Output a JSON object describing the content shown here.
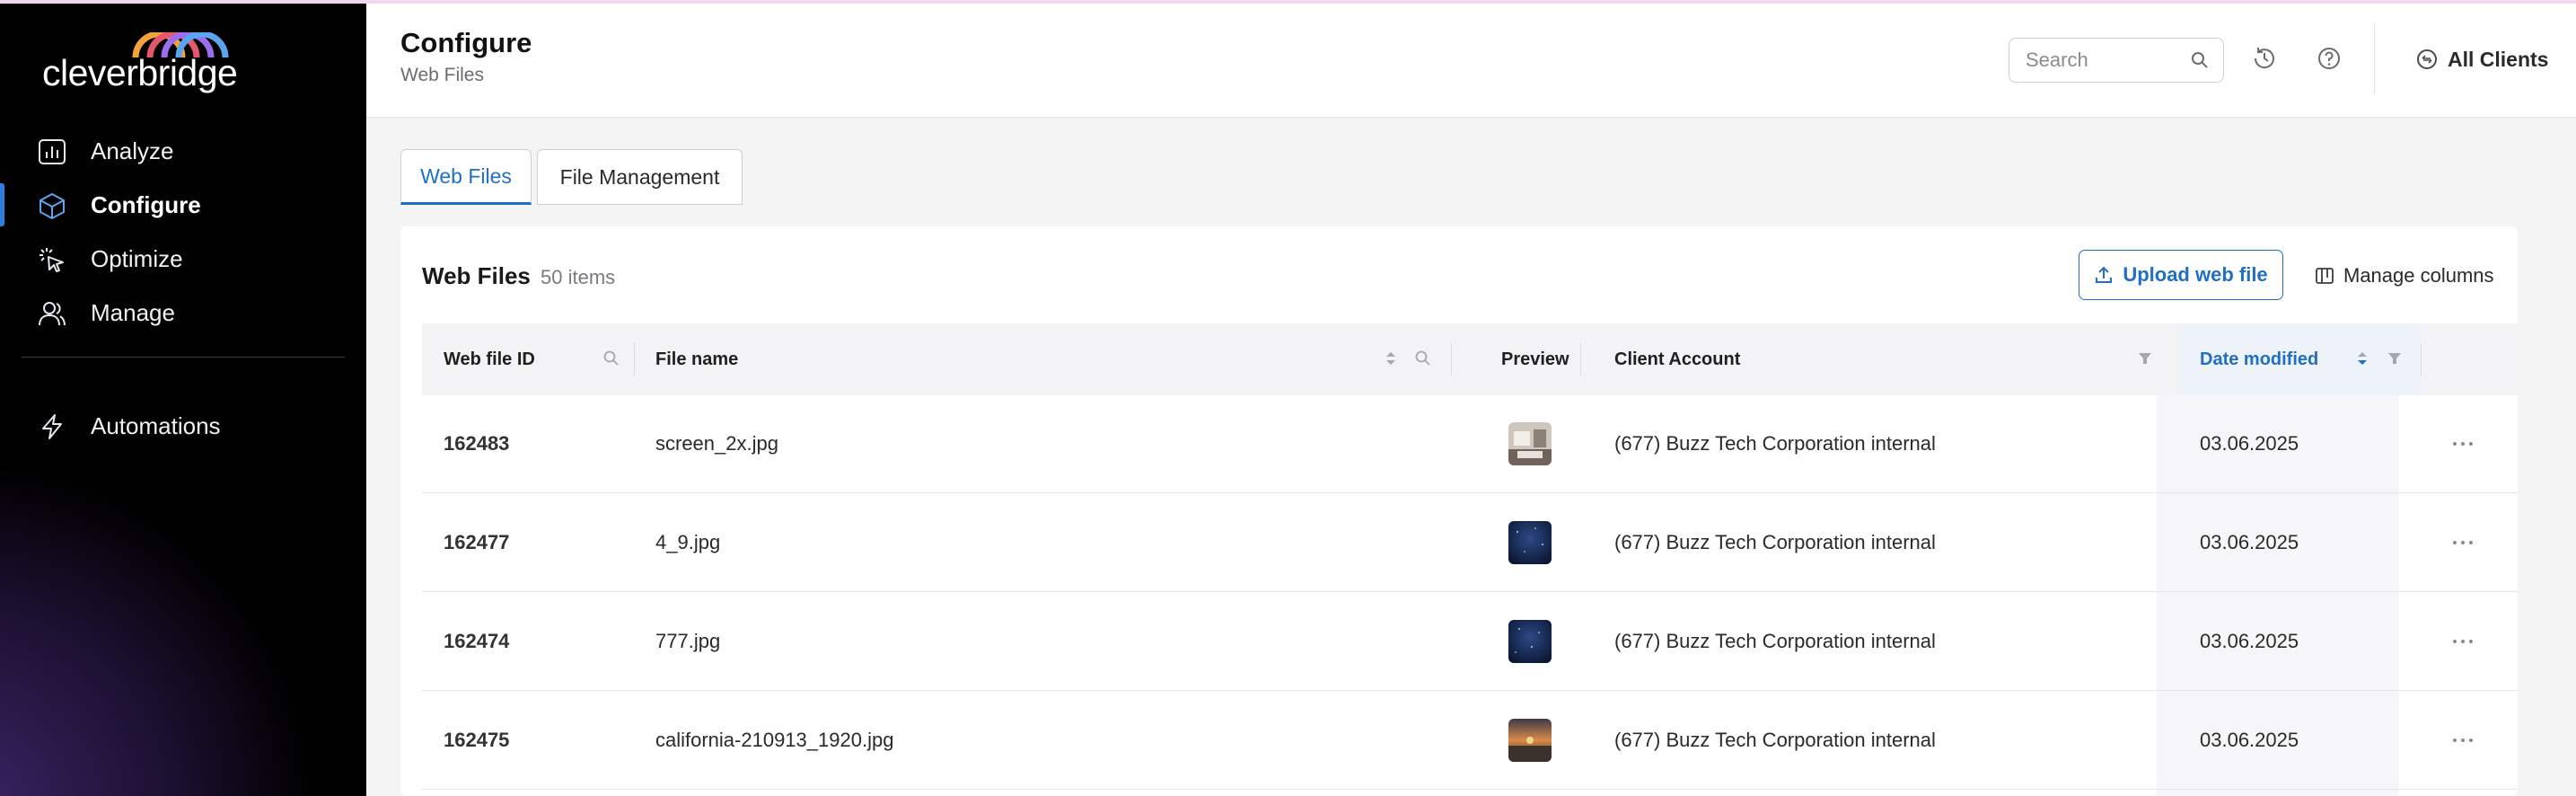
{
  "app": {
    "logo_text": "cleverbridge"
  },
  "sidebar": {
    "items": [
      {
        "label": "Analyze",
        "icon": "chart-icon"
      },
      {
        "label": "Configure",
        "icon": "cube-icon",
        "active": true
      },
      {
        "label": "Optimize",
        "icon": "cursor-click-icon"
      },
      {
        "label": "Manage",
        "icon": "users-icon"
      }
    ],
    "automations": {
      "label": "Automations",
      "icon": "lightning-icon"
    }
  },
  "header": {
    "title": "Configure",
    "subtitle": "Web Files",
    "search_placeholder": "Search",
    "clients_label": "All Clients"
  },
  "tabs": [
    {
      "label": "Web Files",
      "active": true
    },
    {
      "label": "File Management",
      "active": false
    }
  ],
  "card": {
    "title": "Web Files",
    "count": "50 items",
    "upload_label": "Upload web file",
    "manage_columns_label": "Manage columns"
  },
  "table": {
    "columns": {
      "id": "Web file ID",
      "name": "File name",
      "preview": "Preview",
      "account": "Client Account",
      "date": "Date modified"
    },
    "rows": [
      {
        "id": "162483",
        "name": "screen_2x.jpg",
        "account": "(677) Buzz Tech Corporation internal",
        "date": "03.06.2025",
        "thumb": "room"
      },
      {
        "id": "162477",
        "name": "4_9.jpg",
        "account": "(677) Buzz Tech Corporation internal",
        "date": "03.06.2025",
        "thumb": "night"
      },
      {
        "id": "162474",
        "name": "777.jpg",
        "account": "(677) Buzz Tech Corporation internal",
        "date": "03.06.2025",
        "thumb": "night"
      },
      {
        "id": "162475",
        "name": "california-210913_1920.jpg",
        "account": "(677) Buzz Tech Corporation internal",
        "date": "03.06.2025",
        "thumb": "sunset"
      }
    ]
  },
  "colors": {
    "accent": "#1f6fc5",
    "sidebar_bg": "#000000"
  }
}
